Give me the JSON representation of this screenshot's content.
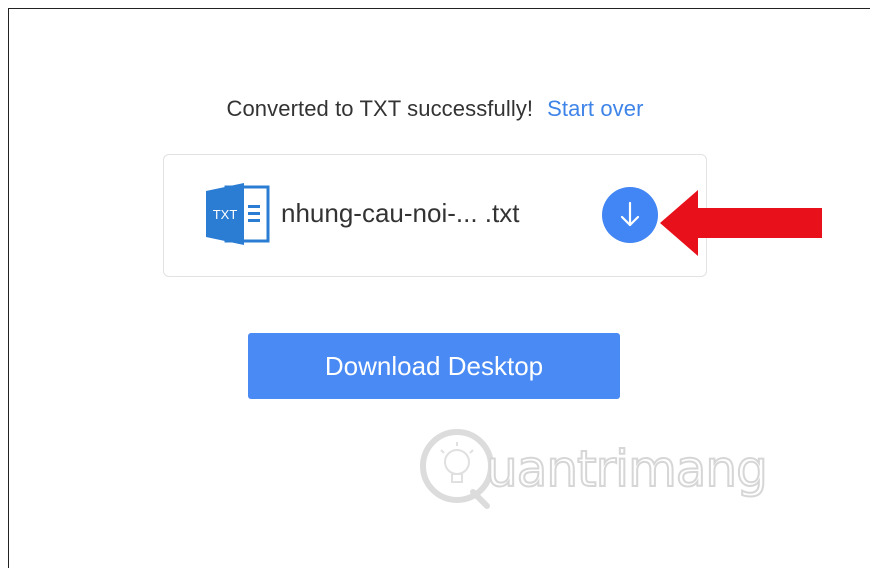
{
  "status": {
    "message": "Converted to TXT successfully!",
    "start_over_label": "Start over"
  },
  "file": {
    "icon_label": "TXT",
    "name": "nhung-cau-noi-... .txt"
  },
  "download_desktop_label": "Download Desktop",
  "watermark": {
    "text": "uantrimang",
    "initial": "Q"
  },
  "colors": {
    "accent": "#4285f4",
    "link": "#3f84e8",
    "annotation_arrow": "#e8101a",
    "file_icon": "#2b7cd3"
  },
  "icons": {
    "file": "txt-file-icon",
    "download": "arrow-down-icon",
    "annotation": "red-arrow-icon",
    "watermark": "lightbulb-icon"
  }
}
